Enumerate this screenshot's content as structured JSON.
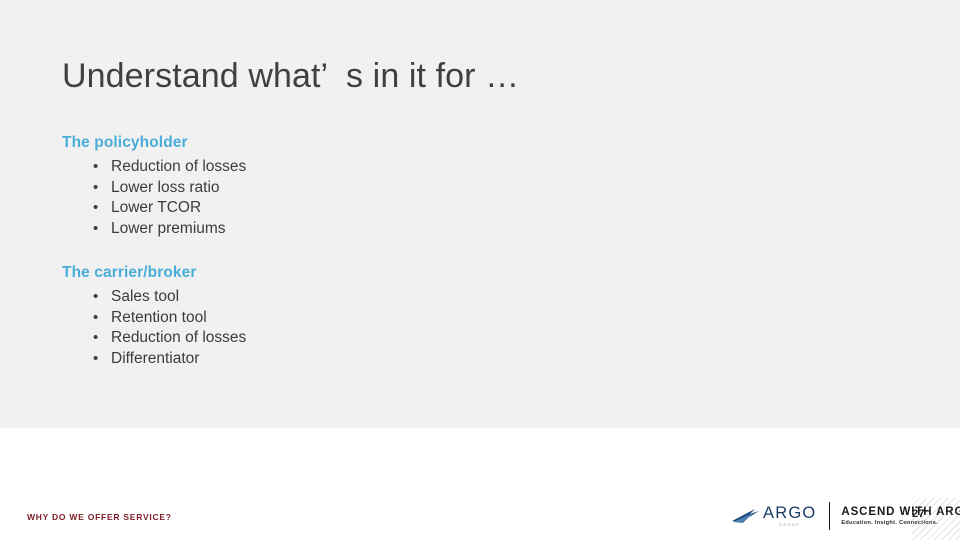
{
  "slide": {
    "title": "Understand what’  s in it for …",
    "background_color": "#f1f1f1",
    "accent_color": "#4aaed8",
    "footer_accent_color": "#7d1c24"
  },
  "sections": [
    {
      "heading": "The policyholder",
      "bullet_marker": "•",
      "items": [
        "Reduction of losses",
        "Lower loss ratio",
        "Lower TCOR",
        "Lower premiums"
      ]
    },
    {
      "heading": "The carrier/broker",
      "bullet_marker": "•",
      "items": [
        "Sales tool",
        "Retention tool",
        "Reduction of losses",
        "Differentiator"
      ]
    }
  ],
  "footer": {
    "section_label": "WHY DO WE OFFER SERVICE?",
    "page_number": "27",
    "brand": {
      "wordmark": "ARGO",
      "wordmark_subtext": "GROUP",
      "program_title": "ASCEND WITH ARGO",
      "program_tagline": "Education. Insight. Connections."
    }
  }
}
